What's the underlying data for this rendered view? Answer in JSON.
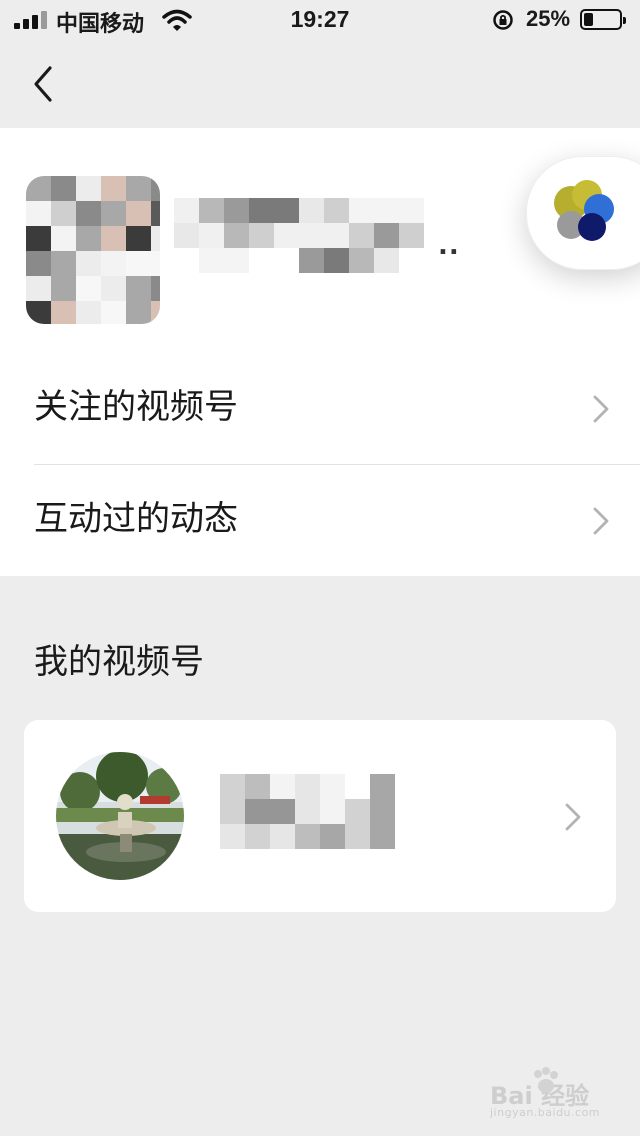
{
  "status_bar": {
    "carrier": "中国移动",
    "time": "19:27",
    "battery_percent": "25%",
    "battery_level": 0.25
  },
  "menu": {
    "followed_channels": "关注的视频号",
    "interacted_posts": "互动过的动态"
  },
  "my_channel": {
    "section_title": "我的视频号"
  },
  "profile": {
    "name_suffix": ".."
  },
  "watermark": {
    "brand": "Bai 经验",
    "url": "jingyan.baidu.com"
  },
  "icons": {
    "back": "chevron-left-icon",
    "row_arrow": "chevron-right-icon",
    "channels": "channels-logo-icon"
  },
  "colors": {
    "page_background": "#ededed",
    "panel_background": "#ffffff",
    "logo_olive": "#b7ad2f",
    "logo_blue": "#2f6fd6",
    "logo_navy": "#0f1a6b",
    "logo_gray": "#9a9a9a"
  }
}
